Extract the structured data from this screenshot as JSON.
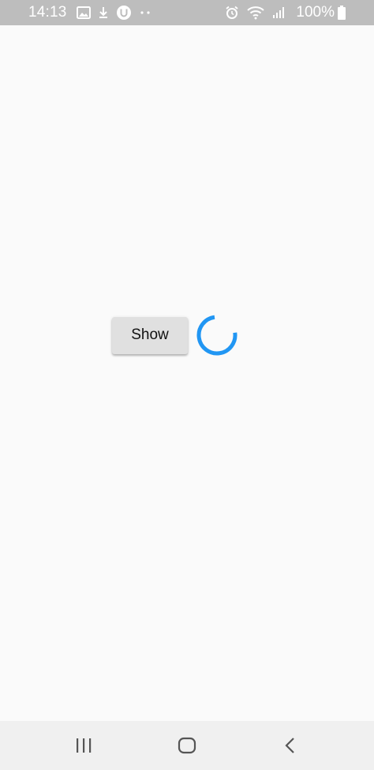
{
  "status_bar": {
    "time": "14:13",
    "battery_text": "100%",
    "left_icons": [
      "image-icon",
      "download-icon",
      "u-badge-icon",
      "more-dots-icon"
    ],
    "right_icons": [
      "alarm-icon",
      "wifi-icon",
      "signal-icon",
      "battery-icon"
    ]
  },
  "main": {
    "show_button_label": "Show"
  },
  "spinner": {
    "color": "#2196f3",
    "arc_fraction": 0.75
  },
  "navigation": {
    "recents_icon": "recents-icon",
    "home_icon": "home-icon",
    "back_icon": "back-icon"
  }
}
